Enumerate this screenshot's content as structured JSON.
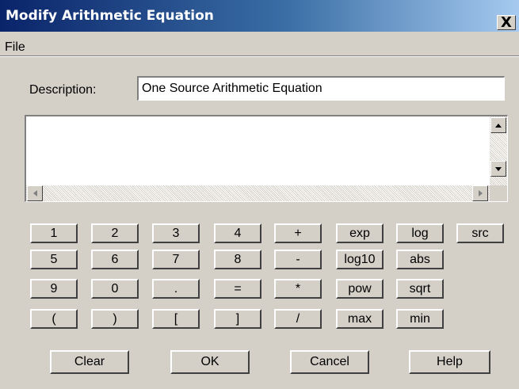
{
  "window": {
    "title": "Modify Arithmetic Equation",
    "close_label": "X"
  },
  "menu": {
    "file": "File"
  },
  "description": {
    "label": "Description:",
    "value": "One Source Arithmetic Equation"
  },
  "editor": {
    "value": ""
  },
  "keypad": {
    "r1": [
      "1",
      "2",
      "3",
      "4",
      "+",
      "exp",
      "log",
      "src"
    ],
    "r2": [
      "5",
      "6",
      "7",
      "8",
      "-",
      "log10",
      "abs"
    ],
    "r3": [
      "9",
      "0",
      ".",
      "=",
      "*",
      "pow",
      "sqrt"
    ],
    "r4": [
      "(",
      ")",
      "[",
      "]",
      "/",
      "max",
      "min"
    ]
  },
  "actions": {
    "clear": "Clear",
    "ok": "OK",
    "cancel": "Cancel",
    "help": "Help"
  },
  "icons": {
    "close": "close-icon",
    "scroll_up": "arrow-up-icon",
    "scroll_down": "arrow-down-icon",
    "scroll_left": "arrow-left-icon",
    "scroll_right": "arrow-right-icon"
  },
  "colors": {
    "titlebar_start": "#0a246a",
    "titlebar_end": "#a6caf0",
    "face": "#d4d0c8"
  }
}
